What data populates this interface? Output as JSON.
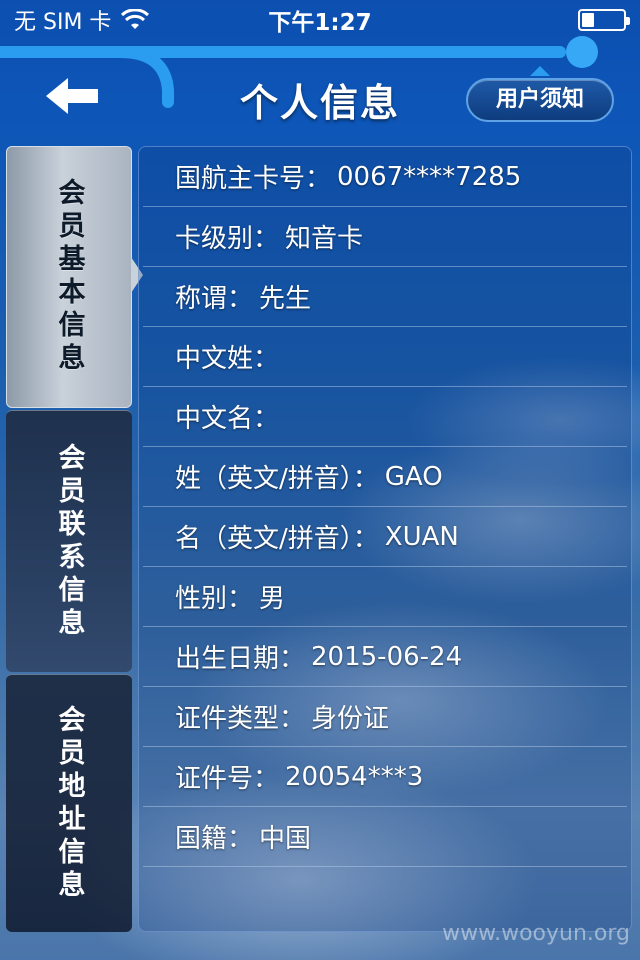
{
  "status_bar": {
    "carrier": "无 SIM 卡",
    "time": "下午1:27",
    "icons": [
      "wifi-icon",
      "battery-icon"
    ]
  },
  "header": {
    "title": "个人信息",
    "back_icon": "arrow-left-icon",
    "notice_label": "用户须知"
  },
  "sidebar": {
    "tabs": [
      {
        "label": "会员基本信息",
        "active": true
      },
      {
        "label": "会员联系信息",
        "active": false
      },
      {
        "label": "会员地址信息",
        "active": false
      }
    ]
  },
  "info": {
    "rows": [
      {
        "label": "国航主卡号：",
        "value": "0067****7285"
      },
      {
        "label": "卡级别：",
        "value": "知音卡"
      },
      {
        "label": "称谓：",
        "value": "先生"
      },
      {
        "label": "中文姓：",
        "value": ""
      },
      {
        "label": "中文名：",
        "value": ""
      },
      {
        "label": "姓（英文/拼音）：",
        "value": "GAO"
      },
      {
        "label": "名（英文/拼音）：",
        "value": "XUAN"
      },
      {
        "label": "性别：",
        "value": "男"
      },
      {
        "label": "出生日期：",
        "value": "2015-06-24"
      },
      {
        "label": "证件类型：",
        "value": "身份证"
      },
      {
        "label": "证件号：",
        "value": "20054***3"
      },
      {
        "label": "国籍：",
        "value": "中国"
      }
    ]
  },
  "watermark": "www.wooyun.org",
  "colors": {
    "accent": "#1e8fe0",
    "background_top": "#0c4fb0",
    "active_tab": "#c9d1da"
  }
}
